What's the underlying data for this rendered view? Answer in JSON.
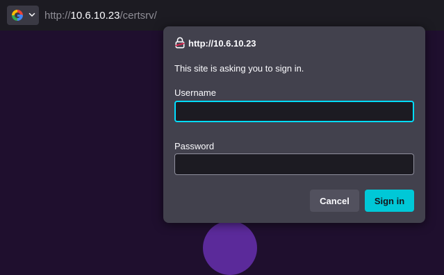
{
  "address_bar": {
    "search_engine_icon": "google-g-icon",
    "dropdown_icon": "chevron-down-icon",
    "url_prefix": "http://",
    "url_host": "10.6.10.23",
    "url_path": "/certsrv/"
  },
  "auth_dialog": {
    "icon": "broken-lock-icon",
    "origin": "http://10.6.10.23",
    "message": "This site is asking you to sign in.",
    "username_label": "Username",
    "username_value": "",
    "password_label": "Password",
    "password_value": "",
    "cancel_label": "Cancel",
    "signin_label": "Sign in"
  },
  "colors": {
    "accent": "#00c8d7",
    "focus_ring": "#00ddff",
    "dialog_bg": "#42414d",
    "page_bg": "#1f0f2e"
  }
}
